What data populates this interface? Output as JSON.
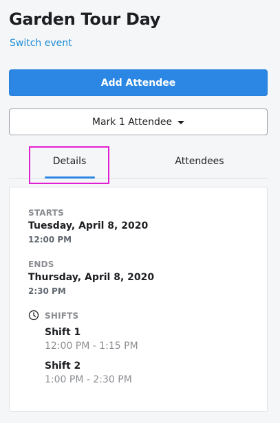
{
  "header": {
    "title": "Garden Tour Day",
    "switch_link": "Switch event"
  },
  "actions": {
    "add_attendee": "Add Attendee",
    "mark_attendee": "Mark 1 Attendee"
  },
  "tabs": [
    {
      "label": "Details",
      "active": true
    },
    {
      "label": "Attendees",
      "active": false
    }
  ],
  "details": {
    "starts_label": "STARTS",
    "starts_date": "Tuesday, April 8, 2020",
    "starts_time": "12:00 PM",
    "ends_label": "ENDS",
    "ends_date": "Thursday, April 8, 2020",
    "ends_time": "2:30 PM",
    "shifts_label": "SHIFTS",
    "shifts": [
      {
        "name": "Shift 1",
        "time": "12:00 PM - 1:15 PM"
      },
      {
        "name": "Shift 2",
        "time": "1:00 PM - 2:30 PM"
      }
    ]
  },
  "colors": {
    "primary": "#2b87e3",
    "link": "#1a8cd8",
    "highlight": "#e21ed2",
    "muted": "#8a8d91"
  },
  "icons": {
    "shifts": "clock-icon",
    "dropdown": "caret-down-icon"
  }
}
